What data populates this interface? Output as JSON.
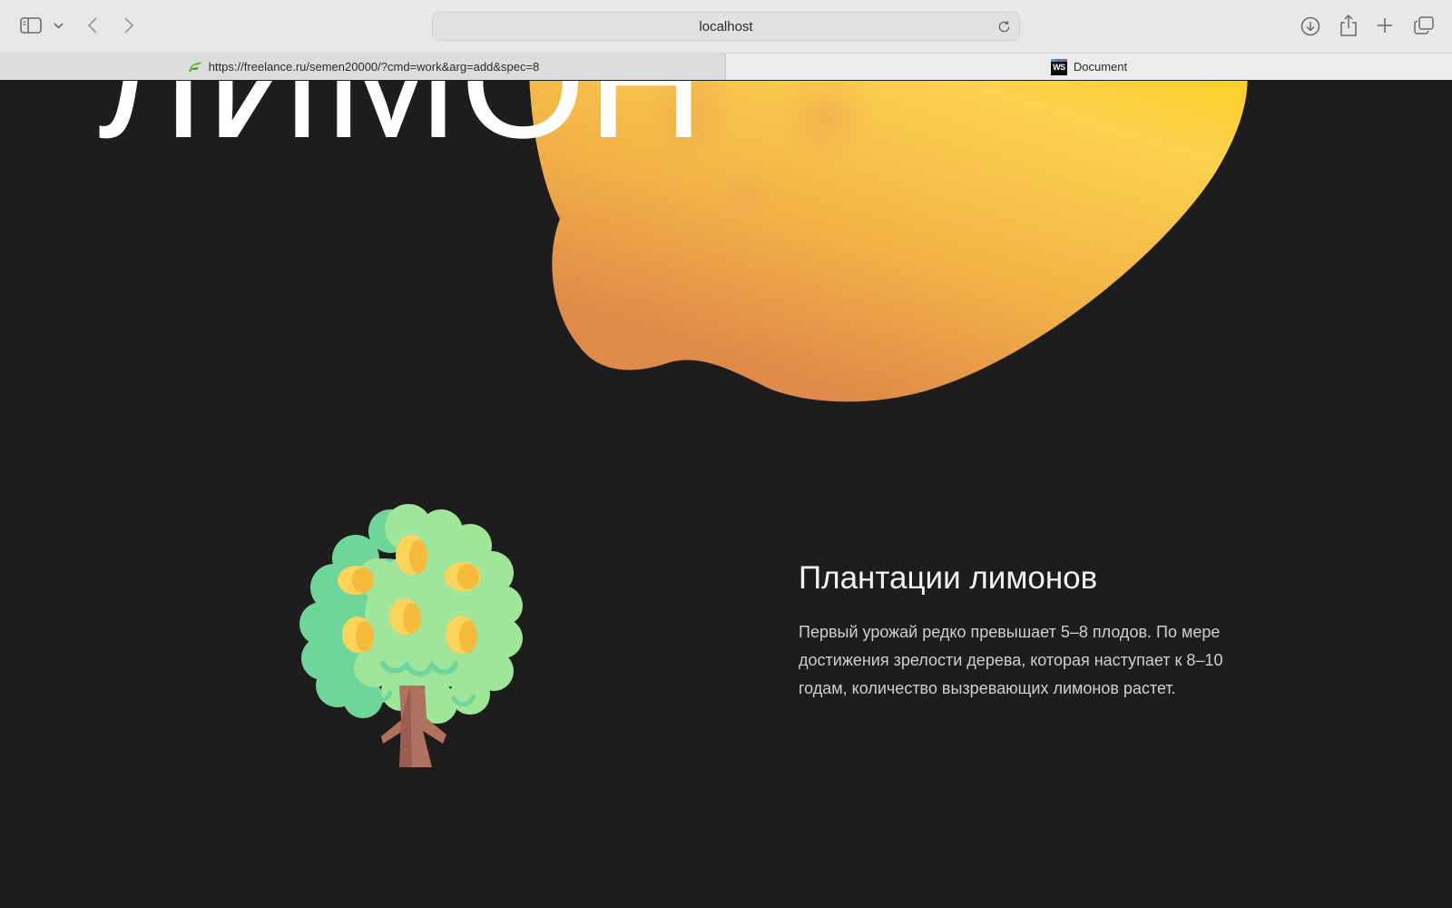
{
  "browser": {
    "address": "localhost",
    "tabs": [
      {
        "title": "https://freelance.ru/semen20000/?cmd=work&arg=add&spec=8",
        "favicon": "freelance-logo-icon",
        "active": false
      },
      {
        "title": "Document",
        "favicon": "webstorm-icon",
        "active": true
      }
    ],
    "icons": {
      "sidebar": "sidebar-icon",
      "sidebar_menu": "chevron-down-icon",
      "back": "chevron-left-icon",
      "forward": "chevron-right-icon",
      "reload": "reload-icon",
      "downloads": "download-icon",
      "share": "share-icon",
      "new_tab": "plus-icon",
      "tab_overview": "tabs-overview-icon"
    }
  },
  "page": {
    "hero_title": "ЛИМОН",
    "section": {
      "title": "Плантации лимонов",
      "text": "Первый урожай редко превышает 5–8 плодов. По мере достижения зрелости дерева, которая наступает к 8–10 годам, количество вызревающих лимонов растет."
    },
    "colors": {
      "background": "#1d1d1d",
      "lemon_light": "#fde04a",
      "lemon_dark": "#e08a4a",
      "leaf": "#8fe0a0"
    }
  }
}
